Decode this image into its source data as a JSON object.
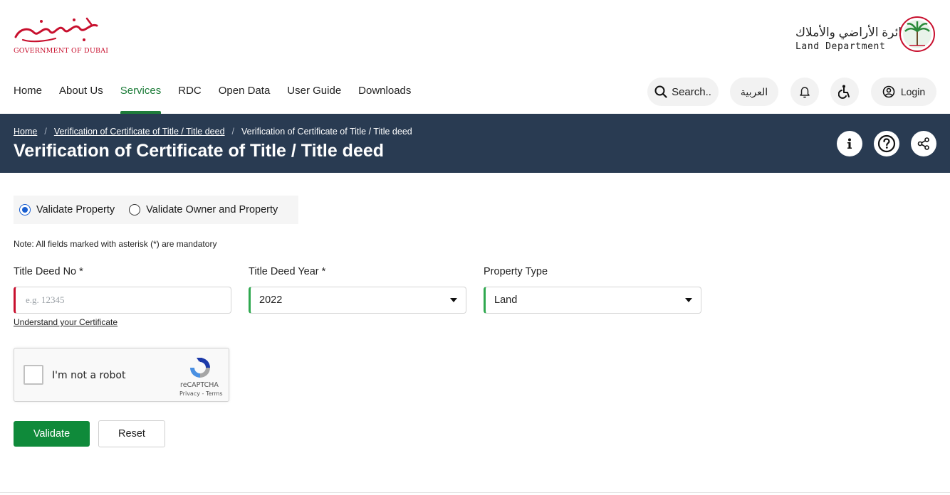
{
  "header": {
    "gov_logo_arabic": "حكومة دبي",
    "gov_logo_text": "GOVERNMENT OF DUBAI",
    "dld_logo_arabic": "دائرة الأراضي والأملاك",
    "dld_logo_english": "Land Department"
  },
  "nav": {
    "items": [
      {
        "label": "Home"
      },
      {
        "label": "About Us"
      },
      {
        "label": "Services",
        "active": true
      },
      {
        "label": "RDC"
      },
      {
        "label": "Open Data"
      },
      {
        "label": "User Guide"
      },
      {
        "label": "Downloads"
      }
    ]
  },
  "actions": {
    "search_label": "Search..",
    "language_label": "العربية",
    "login_label": "Login"
  },
  "banner": {
    "breadcrumbs": [
      "Home",
      "Verification of Certificate of Title / Title deed",
      "Verification of Certificate of Title / Title deed"
    ],
    "title": "Verification of Certificate of Title / Title deed"
  },
  "form": {
    "radio_options": [
      {
        "label": "Validate Property",
        "checked": true
      },
      {
        "label": "Validate Owner and Property",
        "checked": false
      }
    ],
    "note": "Note: All fields marked with asterisk (*) are mandatory",
    "title_deed_no": {
      "label": "Title Deed No *",
      "placeholder": "e.g. 12345",
      "value": ""
    },
    "title_deed_year": {
      "label": "Title Deed Year *",
      "value": "2022"
    },
    "property_type": {
      "label": "Property Type",
      "value": "Land"
    },
    "understand_link": "Understand your Certificate",
    "captcha": {
      "label": "I'm not a robot",
      "brand": "reCAPTCHA",
      "links": "Privacy - Terms"
    },
    "validate_label": "Validate",
    "reset_label": "Reset"
  },
  "colors": {
    "accent_green": "#1e7d3a",
    "banner_navy": "#293b52",
    "brand_red": "#c8102e",
    "radio_blue": "#1a5fd0"
  },
  "icons": [
    "search-icon",
    "bell-icon",
    "accessibility-icon",
    "user-icon",
    "info-icon",
    "help-icon",
    "share-icon",
    "caret-down-icon",
    "recaptcha-icon"
  ]
}
